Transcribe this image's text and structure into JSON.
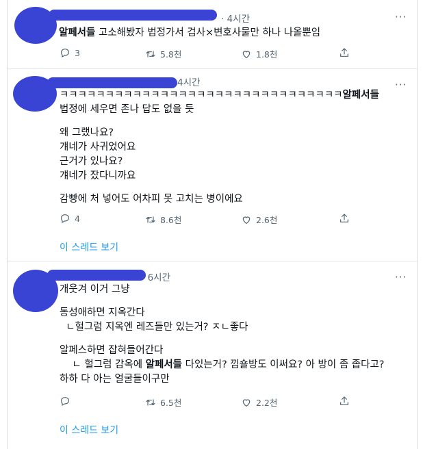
{
  "tweets": [
    {
      "time": "4시간",
      "lines": [
        [
          "알페서들",
          " 고소해봤자 법정가서 검사×변호사물만 하나 나올뿐임"
        ]
      ],
      "replies": "3",
      "retweets": "5.8천",
      "likes": "1.8천"
    },
    {
      "time": "4시간",
      "lines": [
        [
          "",
          "ㅋㅋㅋㅋㅋㅋㅋㅋㅋㅋㅋㅋㅋㅋㅋㅋㅋㅋㅋㅋㅋㅋㅋㅋㅋㅋㅋㅋㅋㅋㅋ"
        ],
        [
          "알페서들",
          ""
        ],
        [
          "",
          "법정에 세우면 존나 답도 없을 듯"
        ],
        [
          "",
          ""
        ],
        [
          "",
          "왜 그랬나요?"
        ],
        [
          "",
          "걔네가 사귀었어요"
        ],
        [
          "",
          "근거가 있나요?"
        ],
        [
          "",
          "걔네가 잤다니까요"
        ],
        [
          "",
          ""
        ],
        [
          "",
          "감빵에 처 넣어도 어차피 못 고치는 병이에요"
        ]
      ],
      "replies": "4",
      "retweets": "8.6천",
      "likes": "2.6천",
      "thread_link": "이 스레드 보기"
    },
    {
      "time": "6시간",
      "lines": [
        [
          "",
          "개웃겨 이거 그냥"
        ],
        [
          "",
          ""
        ],
        [
          "",
          "동성애하면 지옥간다"
        ],
        [
          "",
          "  ㄴ헐그럼 지옥엔 레즈들만 있는거? ㅈㄴ좋다"
        ],
        [
          "",
          ""
        ],
        [
          "",
          "알페스하면 잡혀들어간다"
        ],
        [
          "",
          "    ㄴ 헐그럼 감옥에 "
        ],
        [
          "알페서들",
          " 다있는거? 낌숄방도 이써요? 아 방이 좀 좁다고?"
        ],
        [
          "",
          "하하 다 아는 얼굴들이구만"
        ]
      ],
      "replies": "",
      "retweets": "6.5천",
      "likes": "2.2천",
      "thread_link": "이 스레드 보기"
    }
  ],
  "icons": {
    "reply": "reply-icon",
    "retweet": "retweet-icon",
    "like": "like-icon",
    "share": "share-icon",
    "more": "more-icon"
  },
  "colors": {
    "scribble": "#3a44d4",
    "link": "#1d9bf0",
    "muted": "#536471"
  }
}
